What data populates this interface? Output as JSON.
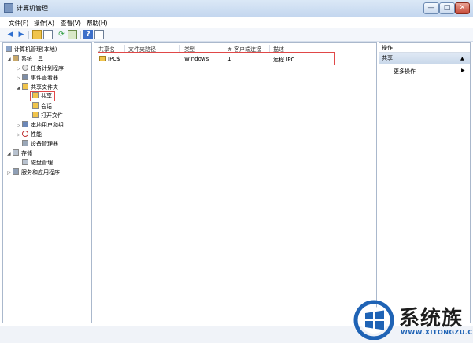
{
  "window": {
    "title": "计算机管理",
    "min_glyph": "—",
    "max_glyph": "□",
    "close_glyph": "✕"
  },
  "menu": [
    "文件(F)",
    "操作(A)",
    "查看(V)",
    "帮助(H)"
  ],
  "toolbar": {
    "icons": [
      "back-arrow-icon",
      "forward-arrow-icon",
      "up-folder-icon",
      "show-hide-tree-icon",
      "refresh-icon",
      "export-list-icon",
      "help-icon",
      "properties-icon"
    ]
  },
  "tree": {
    "root": "计算机管理(本地)",
    "system_tools": "系统工具",
    "task_scheduler": "任务计划程序",
    "event_viewer": "事件查看器",
    "shared_folders": "共享文件夹",
    "shares": "共享",
    "sessions": "会话",
    "open_files": "打开文件",
    "local_users": "本地用户和组",
    "performance": "性能",
    "device_manager": "设备管理器",
    "storage": "存储",
    "disk_management": "磁盘管理",
    "services_apps": "服务和应用程序"
  },
  "list": {
    "columns": [
      "共享名",
      "文件夹路径",
      "类型",
      "# 客户端连接",
      "描述"
    ],
    "rows": [
      {
        "name": "IPC$",
        "path": "",
        "type": "Windows",
        "clients": "1",
        "desc": "远程 IPC"
      }
    ]
  },
  "actions": {
    "header": "操作",
    "section": "共享",
    "more": "更多操作",
    "more_arrow": "▶",
    "collapse_arrow": "▲"
  },
  "watermark": {
    "text": "系统族",
    "url": "WWW.XITONGZU.COM"
  },
  "colors": {
    "highlight_border": "#e04848",
    "accent_blue": "#1f63b5"
  }
}
